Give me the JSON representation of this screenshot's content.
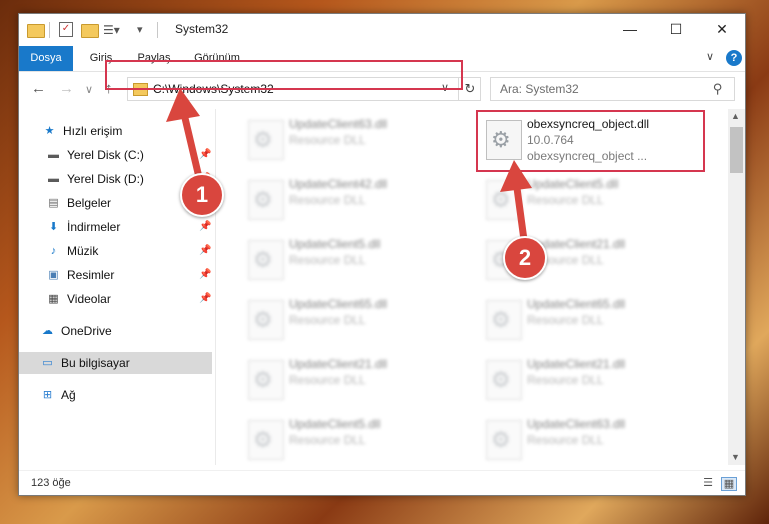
{
  "window": {
    "title": "System32",
    "minimize_glyph": "—",
    "maximize_glyph": "☐",
    "close_glyph": "✕"
  },
  "ribbon": {
    "tabs": [
      {
        "label": "Dosya",
        "active": true
      },
      {
        "label": "Giriş"
      },
      {
        "label": "Paylaş"
      },
      {
        "label": "Görünüm"
      }
    ],
    "help_label": "?",
    "expand_glyph": "∨"
  },
  "nav": {
    "back_glyph": "←",
    "forward_glyph": "→",
    "up_glyph": "↑",
    "address": "C:\\Windows\\System32",
    "address_dropdown_glyph": "∨",
    "refresh_glyph": "↻",
    "search_placeholder": "Ara: System32",
    "search_glyph": "⚲"
  },
  "sidebar": {
    "items": [
      {
        "label": "Hızlı erişim",
        "icon": "star-icon",
        "glyph": "★",
        "color": "#1979ca",
        "pinned": false
      },
      {
        "label": "Yerel Disk (C:)",
        "icon": "drive-icon",
        "glyph": "▬",
        "color": "#5b5b5b",
        "pinned": true
      },
      {
        "label": "Yerel Disk (D:)",
        "icon": "drive-icon",
        "glyph": "▬",
        "color": "#5b5b5b",
        "pinned": true
      },
      {
        "label": "Belgeler",
        "icon": "documents-icon",
        "glyph": "▤",
        "color": "#6a6a6a",
        "pinned": true
      },
      {
        "label": "İndirmeler",
        "icon": "download-icon",
        "glyph": "⬇",
        "color": "#1979ca",
        "pinned": true
      },
      {
        "label": "Müzik",
        "icon": "music-icon",
        "glyph": "♪",
        "color": "#1979ca",
        "pinned": true
      },
      {
        "label": "Resimler",
        "icon": "pictures-icon",
        "glyph": "▣",
        "color": "#4a7fb5",
        "pinned": true
      },
      {
        "label": "Videolar",
        "icon": "videos-icon",
        "glyph": "▦",
        "color": "#444444",
        "pinned": true
      },
      {
        "label": "OneDrive",
        "icon": "cloud-icon",
        "glyph": "☁",
        "color": "#1979ca",
        "pinned": false
      },
      {
        "label": "Bu bilgisayar",
        "icon": "computer-icon",
        "glyph": "▭",
        "color": "#2c7fd1",
        "pinned": false,
        "selected": true
      },
      {
        "label": "Ağ",
        "icon": "network-icon",
        "glyph": "⊞",
        "color": "#2c7fd1",
        "pinned": false
      }
    ],
    "pin_glyph": "📌"
  },
  "files": {
    "highlighted": {
      "name": "obexsyncreq_object.dll",
      "version": "10.0.764",
      "description": "obexsyncreq_object ..."
    },
    "blurred_left": [
      {
        "name": "UpdateClient63.dll",
        "type": "Resource DLL"
      },
      {
        "name": "UpdateClient42.dll",
        "type": "Resource DLL"
      },
      {
        "name": "UpdateClient5.dll",
        "type": "Resource DLL"
      },
      {
        "name": "UpdateClient65.dll",
        "type": "Resource DLL"
      },
      {
        "name": "UpdateClient21.dll",
        "type": "Resource DLL"
      },
      {
        "name": "UpdateClient5.dll",
        "type": "Resource DLL"
      }
    ],
    "blurred_right": [
      {
        "name": "UpdateClient5.dll",
        "type": "Resource DLL"
      },
      {
        "name": "UpdateClient21.dll",
        "type": "Resource DLL"
      },
      {
        "name": "UpdateClient65.dll",
        "type": "Resource DLL"
      },
      {
        "name": "UpdateClient21.dll",
        "type": "Resource DLL"
      },
      {
        "name": "UpdateClient63.dll",
        "type": "Resource DLL"
      }
    ]
  },
  "status": {
    "item_count": "123 öğe"
  },
  "annotations": {
    "step1": "1",
    "step2": "2",
    "highlight_color": "#d5364f",
    "badge_color": "#d9463e"
  }
}
